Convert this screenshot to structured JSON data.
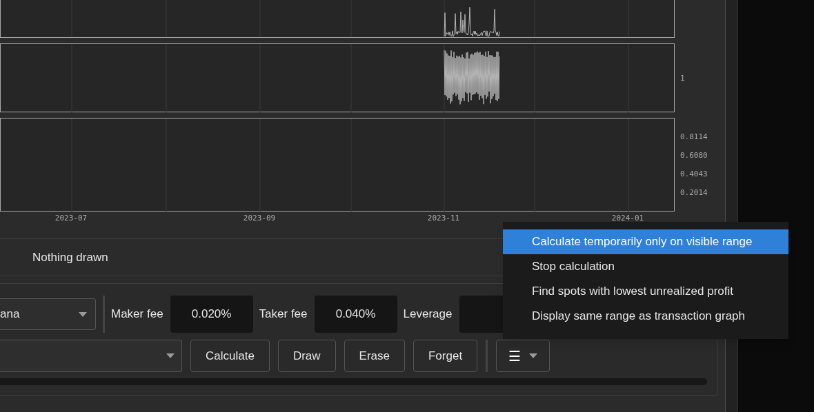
{
  "charts": [
    {
      "kind": "spikes"
    },
    {
      "kind": "band",
      "y_labels": [
        "1"
      ]
    },
    {
      "kind": "empty",
      "y_labels": [
        "0.8114",
        "0.6080",
        "0.4043",
        "0.2014"
      ]
    }
  ],
  "x_labels": [
    "2023-07",
    "2023-09",
    "2023-11",
    "2024-01"
  ],
  "status": "Nothing drawn",
  "strategy_select": {
    "value": "ana"
  },
  "fees": [
    {
      "label": "Maker fee",
      "value": "0.020%"
    },
    {
      "label": "Taker fee",
      "value": "0.040%"
    }
  ],
  "leverage": {
    "label": "Leverage"
  },
  "buttons": [
    "Calculate",
    "Draw",
    "Erase",
    "Forget"
  ],
  "menu_button": {
    "icon": "☰"
  },
  "menu": {
    "items": [
      {
        "label": "Calculate temporarily only on visible range",
        "selected": true
      },
      {
        "label": "Stop calculation",
        "selected": false
      },
      {
        "label": "Find spots with lowest unrealized profit",
        "selected": false
      },
      {
        "label": "Display same range as transaction graph",
        "selected": false
      }
    ]
  }
}
